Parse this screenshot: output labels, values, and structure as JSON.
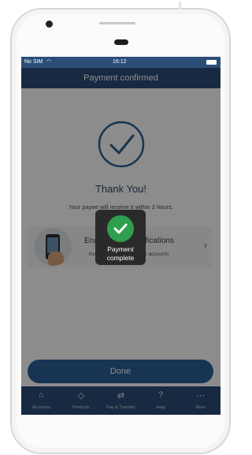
{
  "status_bar": {
    "carrier": "No SIM",
    "wifi_icon": "wifi-icon",
    "time": "16:12",
    "battery_icon": "battery-icon"
  },
  "header": {
    "title": "Payment confirmed"
  },
  "confirmation": {
    "icon": "check-circle-icon",
    "title": "Thank You!",
    "subtitle": "Your payee will receive it within 2 hours."
  },
  "promo": {
    "title": "Enable Push Notifications",
    "subtitle": "Keep up to date with your accounts",
    "chevron": "›"
  },
  "done_label": "Done",
  "tabs": [
    {
      "label": "Accounts",
      "icon": "home-icon",
      "glyph": "⌂"
    },
    {
      "label": "Products",
      "icon": "tag-icon",
      "glyph": "◇"
    },
    {
      "label": "Pay & Transfer",
      "icon": "transfer-icon",
      "glyph": "⇄"
    },
    {
      "label": "Help",
      "icon": "help-icon",
      "glyph": "?"
    },
    {
      "label": "More",
      "icon": "more-icon",
      "glyph": "⋯"
    }
  ],
  "toast": {
    "icon": "checkmark-icon",
    "line1": "Payment",
    "line2": "complete"
  },
  "colors": {
    "brand": "#2b4e78",
    "button": "#2b5f95",
    "success": "#2f9e4e"
  }
}
